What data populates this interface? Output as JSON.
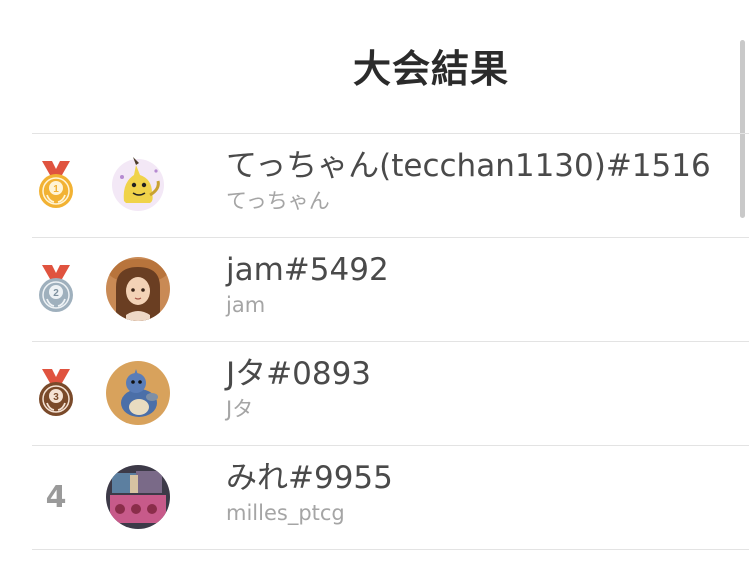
{
  "header": {
    "title": "大会結果"
  },
  "results": [
    {
      "rank": "1",
      "medal": "gold-medal-icon",
      "display_name": "てっちゃん(tecchan1130)#1516",
      "sub_name": "てっちゃん",
      "avatar": "mimikyu-avatar"
    },
    {
      "rank": "2",
      "medal": "silver-medal-icon",
      "display_name": "jam#5492",
      "sub_name": "jam",
      "avatar": "girl-hat-avatar"
    },
    {
      "rank": "3",
      "medal": "bronze-medal-icon",
      "display_name": "Jタ#0893",
      "sub_name": "Jタ",
      "avatar": "lapras-avatar"
    },
    {
      "rank": "4",
      "medal": null,
      "display_name": "みれ#9955",
      "sub_name": "milles_ptcg",
      "avatar": "cards-avatar"
    }
  ],
  "colors": {
    "gold": "#f2b233",
    "silver": "#9fb0bd",
    "bronze": "#7a4a2a",
    "ribbon": "#e0533f"
  }
}
